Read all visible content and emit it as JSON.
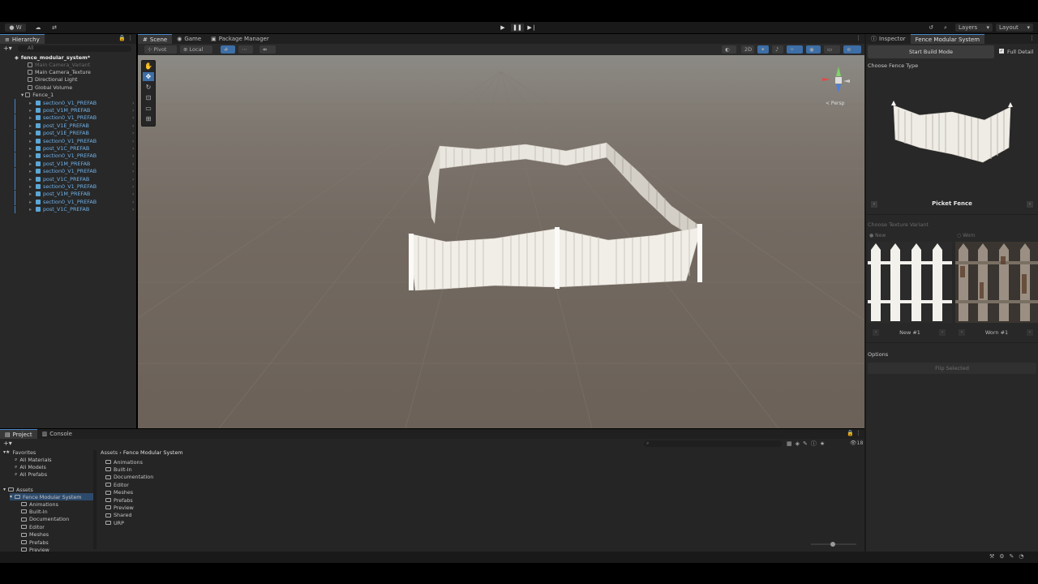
{
  "toolbar": {
    "account_label": "W",
    "layers_label": "Layers",
    "layout_label": "Layout"
  },
  "hierarchy": {
    "tab": "Hierarchy",
    "search_placeholder": "All",
    "scene_name": "fence_modular_system*",
    "items": [
      {
        "label": "Main Camera_Variant",
        "kind": "grey-dim"
      },
      {
        "label": "Main Camera_Texture",
        "kind": "grey"
      },
      {
        "label": "Directional Light",
        "kind": "grey"
      },
      {
        "label": "Global Volume",
        "kind": "grey"
      },
      {
        "label": "Fence_1",
        "kind": "grey"
      },
      {
        "label": "section0_V1_PREFAB",
        "kind": "prefab"
      },
      {
        "label": "post_V1M_PREFAB",
        "kind": "prefab"
      },
      {
        "label": "section0_V1_PREFAB",
        "kind": "prefab"
      },
      {
        "label": "post_V1E_PREFAB",
        "kind": "prefab"
      },
      {
        "label": "post_V1E_PREFAB",
        "kind": "prefab"
      },
      {
        "label": "section0_V1_PREFAB",
        "kind": "prefab"
      },
      {
        "label": "post_V1C_PREFAB",
        "kind": "prefab"
      },
      {
        "label": "section0_V1_PREFAB",
        "kind": "prefab"
      },
      {
        "label": "post_V1M_PREFAB",
        "kind": "prefab"
      },
      {
        "label": "section0_V1_PREFAB",
        "kind": "prefab"
      },
      {
        "label": "post_V1C_PREFAB",
        "kind": "prefab"
      },
      {
        "label": "section0_V1_PREFAB",
        "kind": "prefab"
      },
      {
        "label": "post_V1M_PREFAB",
        "kind": "prefab"
      },
      {
        "label": "section0_V1_PREFAB",
        "kind": "prefab"
      },
      {
        "label": "post_V1C_PREFAB",
        "kind": "prefab"
      }
    ]
  },
  "center_tabs": {
    "scene": "Scene",
    "game": "Game",
    "package_manager": "Package Manager"
  },
  "scene_toolbar": {
    "pivot": "Pivot",
    "local": "Local",
    "mode_2d": "2D"
  },
  "gizmo": {
    "persp_label": "< Persp"
  },
  "inspector": {
    "tab_inspector": "Inspector",
    "tab_fence": "Fence Modular System",
    "start_build_mode": "Start Build Mode",
    "full_detail": "Full Detail",
    "choose_fence_type": "Choose Fence Type",
    "fence_type_name": "Picket Fence",
    "choose_texture_variant": "Choose Texture Variant",
    "variant_new": "New",
    "variant_worn": "Worn",
    "variant_new_name": "New #1",
    "variant_worn_name": "Worn #1",
    "options": "Options",
    "flip_selected": "Flip Selected"
  },
  "project": {
    "tab_project": "Project",
    "tab_console": "Console",
    "favorites": "Favorites",
    "fav_items": [
      "All Materials",
      "All Models",
      "All Prefabs"
    ],
    "assets": "Assets",
    "tree_root": "Fence Modular System",
    "tree_items": [
      "Animations",
      "Built-In",
      "Documentation",
      "Editor",
      "Meshes",
      "Prefabs",
      "Preview"
    ],
    "breadcrumb_root": "Assets",
    "breadcrumb_child": "Fence Modular System",
    "folders": [
      "Animations",
      "Built-In",
      "Documentation",
      "Editor",
      "Meshes",
      "Prefabs",
      "Preview",
      "Shared",
      "URP"
    ],
    "count_badge": "18"
  },
  "colors": {
    "accent": "#4a86c8",
    "prefab": "#6fb1e8",
    "scene_ground": "#736a62"
  }
}
